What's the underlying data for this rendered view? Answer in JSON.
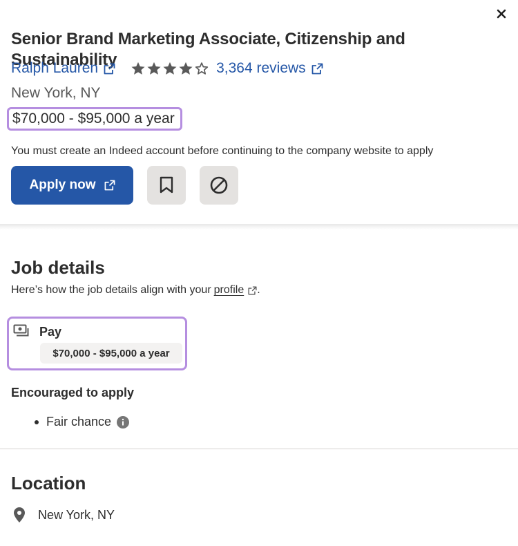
{
  "header": {
    "job_title": "Senior Brand Marketing Associate, Citizenship and Sustainability",
    "company_name": "Ralph Lauren",
    "rating": 4,
    "rating_max": 5,
    "reviews_label": "3,364 reviews",
    "location": "New York, NY",
    "salary": "$70,000 - $95,000 a year",
    "notice": "You must create an Indeed account before continuing to the company website to apply",
    "apply_label": "Apply now"
  },
  "job_details": {
    "title": "Job details",
    "subtitle": "Here’s how the job details align with your",
    "profile_link": "profile",
    "subtitle_end": ".",
    "pay_label": "Pay",
    "pay_value": "$70,000 - $95,000 a year",
    "encouraged_title": "Encouraged to apply",
    "encouraged_items": [
      "Fair chance"
    ]
  },
  "location_section": {
    "title": "Location",
    "value": "New York, NY"
  },
  "colors": {
    "link_blue": "#2557a7",
    "highlight_purple": "#b58ee0",
    "icon_button_bg": "#e4e2e0",
    "text": "#2d2d2d"
  },
  "icons": [
    "close-icon",
    "external-link-icon",
    "star-icon",
    "bookmark-icon",
    "not-interested-icon",
    "money-icon",
    "info-icon",
    "location-pin-icon"
  ]
}
